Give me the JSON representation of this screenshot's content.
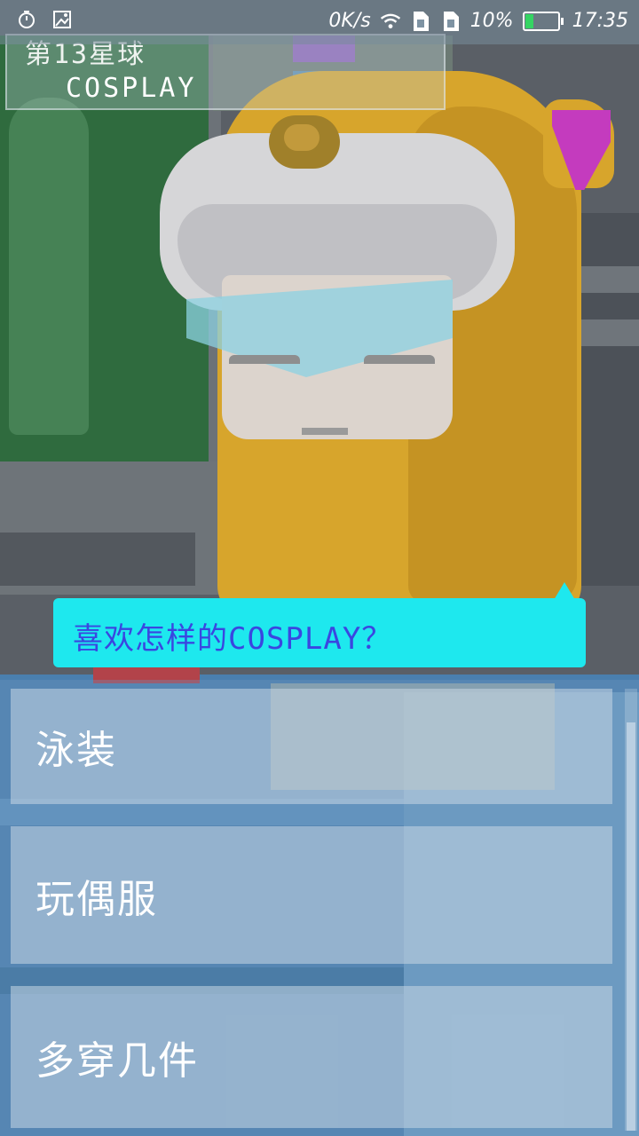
{
  "status_bar": {
    "network_speed": "0K/s",
    "battery_percent": "10%",
    "battery_level": 0.1,
    "time": "17:35",
    "icons": [
      "timer-icon",
      "image-icon",
      "wifi-icon",
      "sim1-icon",
      "sim2-icon",
      "battery-charging-icon"
    ]
  },
  "stage": {
    "title_line1": "第13星球",
    "title_line2": "COSPLAY"
  },
  "dialog": {
    "question": "喜欢怎样的COSPLAY？"
  },
  "choices": [
    {
      "label": "泳装"
    },
    {
      "label": "玩偶服"
    },
    {
      "label": "多穿几件"
    }
  ],
  "colors": {
    "bubble": "#1ee8ee",
    "bubble_text": "#3a46e0",
    "character": "#d7a52c",
    "battery_fill": "#35d463"
  }
}
